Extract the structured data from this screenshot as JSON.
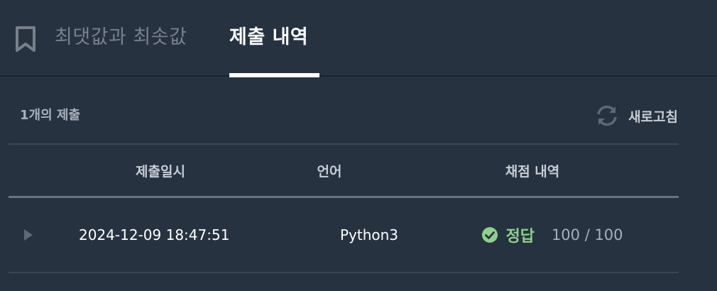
{
  "tabs": {
    "problem_title": "최댓값과 최솟값",
    "active_label": "제출 내역"
  },
  "summary": "1개의 제출",
  "refresh_label": "새로고침",
  "table": {
    "headers": [
      "제출일시",
      "언어",
      "채점 내역"
    ],
    "rows": [
      {
        "submitted_at": "2024-12-09 18:47:51",
        "language": "Python3",
        "result": "정답",
        "score": "100 / 100"
      }
    ]
  },
  "colors": {
    "background": "#263240",
    "accept": "#8fcf8c",
    "muted": "#78808a"
  },
  "icons": [
    "bookmark-icon",
    "refresh-icon",
    "play-icon",
    "check-circle-icon"
  ]
}
